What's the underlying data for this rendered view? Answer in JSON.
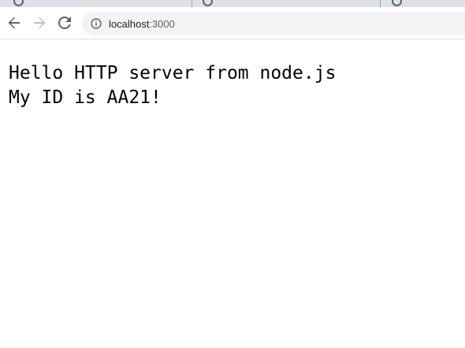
{
  "browser": {
    "url": {
      "host": "localhost",
      "port": ":3000"
    },
    "icons": {
      "back": "arrow-left-icon",
      "forward": "arrow-right-icon",
      "reload": "reload-icon",
      "site_info": "info-icon",
      "tab_favicon": "globe-icon"
    },
    "colors": {
      "tabstrip": "#dee1e6",
      "omnibox": "#f1f3f4",
      "icon": "#5f6368",
      "icon_disabled": "#bdc1c6"
    }
  },
  "page": {
    "lines": [
      "Hello HTTP server from node.js",
      "My ID is AA21!"
    ]
  }
}
